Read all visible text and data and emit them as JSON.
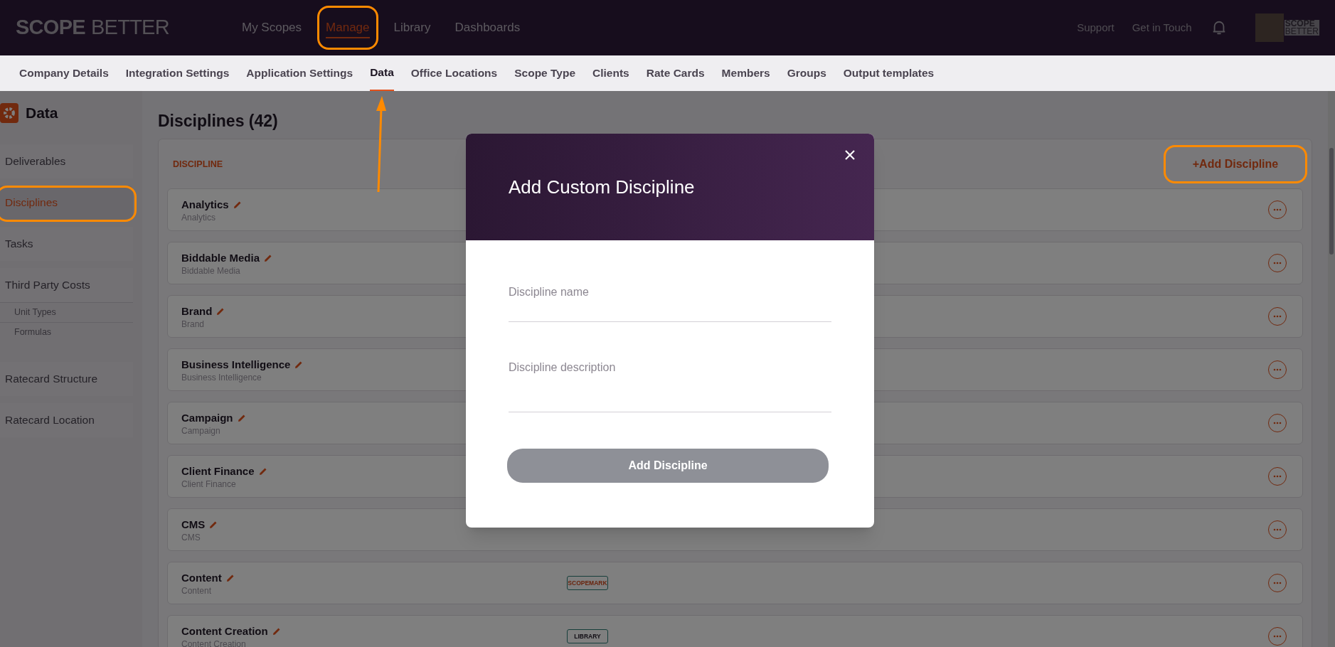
{
  "header": {
    "logo": [
      "SCOPE",
      "BETTER"
    ],
    "nav": [
      {
        "label": "My Scopes",
        "selected": false
      },
      {
        "label": "Manage",
        "selected": true,
        "annotated": true
      },
      {
        "label": "Library",
        "selected": false
      },
      {
        "label": "Dashboards",
        "selected": false
      }
    ],
    "utility_links": [
      "Support",
      "Get in Touch"
    ],
    "account_logo": [
      "SCOPE",
      "BETTER"
    ]
  },
  "subnav": [
    {
      "label": "Company Details",
      "selected": false
    },
    {
      "label": "Integration Settings",
      "selected": false
    },
    {
      "label": "Application Settings",
      "selected": false
    },
    {
      "label": "Data",
      "selected": true,
      "annotated": true
    },
    {
      "label": "Office Locations",
      "selected": false
    },
    {
      "label": "Scope Type",
      "selected": false
    },
    {
      "label": "Clients",
      "selected": false
    },
    {
      "label": "Rate Cards",
      "selected": false
    },
    {
      "label": "Members",
      "selected": false
    },
    {
      "label": "Groups",
      "selected": false
    },
    {
      "label": "Output templates",
      "selected": false
    }
  ],
  "sidebar": {
    "title": "Data",
    "items": [
      {
        "label": "Deliverables",
        "selected": false
      },
      {
        "label": "Disciplines",
        "selected": true,
        "annotated": true
      },
      {
        "label": "Tasks",
        "selected": false
      },
      {
        "label": "Third Party Costs",
        "selected": false,
        "children": [
          {
            "label": "Unit Types"
          },
          {
            "label": "Formulas"
          }
        ]
      },
      {
        "label": "Ratecard Structure",
        "selected": false
      },
      {
        "label": "Ratecard Location",
        "selected": false
      }
    ]
  },
  "content": {
    "title": "Disciplines (42)",
    "column": "DISCIPLINE",
    "add_button": {
      "label": "+Add Discipline",
      "annotated": true
    },
    "rows": [
      {
        "name": "Analytics",
        "description": "Analytics"
      },
      {
        "name": "Biddable Media",
        "description": "Biddable Media"
      },
      {
        "name": "Brand",
        "description": "Brand"
      },
      {
        "name": "Business Intelligence",
        "description": "Business Intelligence"
      },
      {
        "name": "Campaign",
        "description": "Campaign"
      },
      {
        "name": "Client Finance",
        "description": "Client Finance"
      },
      {
        "name": "CMS",
        "description": "CMS"
      },
      {
        "name": "Content",
        "description": "Content",
        "badge": {
          "label": "SCOPEMARK",
          "kind": "scopemark"
        }
      },
      {
        "name": "Content Creation",
        "description": "Content Creation",
        "badge": {
          "label": "LIBRARY",
          "kind": "library"
        }
      }
    ]
  },
  "modal": {
    "title": "Add Custom Discipline",
    "fields": [
      {
        "placeholder": "Discipline name",
        "kind": "line"
      },
      {
        "placeholder": "Discipline description",
        "kind": "area"
      }
    ],
    "submit": {
      "label": "Add Discipline",
      "disabled": true
    }
  }
}
